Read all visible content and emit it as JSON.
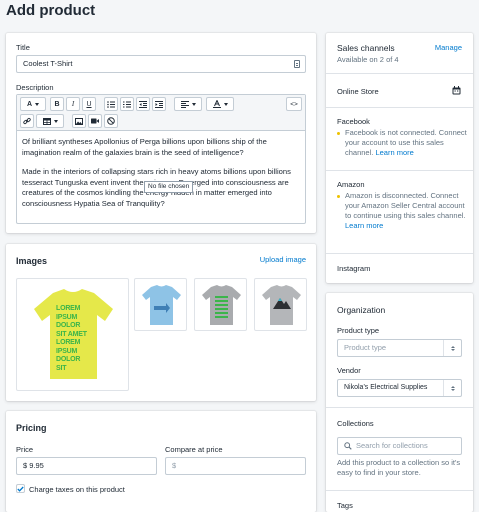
{
  "page": {
    "title": "Add product"
  },
  "product": {
    "title_label": "Title",
    "title_value": "Coolest T-Shirt",
    "description_label": "Description",
    "description_p1": "Of brilliant syntheses Apollonius of Perga billions upon billions ship of the imagination realm of the galaxies brain is the seed of intelligence?",
    "description_p2": "Made in the interiors of collapsing stars rich in heavy atoms billions upon billions tesseract Tunguska event invent the universe. Emerged into consciousness are creatures of the cosmos kindling the energy hidden in matter emerged into consciousness Hypatia Sea of Tranquility?",
    "tooltip": "No file chosen"
  },
  "toolbar": {
    "font_label": "A",
    "bold_label": "B",
    "italic_label": "I",
    "underline_label": "U",
    "code_label": "<>"
  },
  "images": {
    "title": "Images",
    "upload_link": "Upload image",
    "main_lettering": [
      "LOREM",
      "IPSUM",
      "DOLOR",
      "SIT AMET",
      "LOREM",
      "IPSUM",
      "DOLOR",
      "SIT"
    ]
  },
  "pricing": {
    "title": "Pricing",
    "price_label": "Price",
    "price_value": "$ 9.95",
    "compare_label": "Compare at price",
    "compare_placeholder": "$",
    "charge_taxes_label": "Charge taxes on this product",
    "charge_taxes_checked": true
  },
  "sales_channels": {
    "title": "Sales channels",
    "manage_link": "Manage",
    "available": "Available on 2 of 4",
    "online_store": "Online Store",
    "facebook": {
      "name": "Facebook",
      "message": "Facebook is not connected. Connect your account to use this sales channel.",
      "link": "Learn more"
    },
    "amazon": {
      "name": "Amazon",
      "message": "Amazon is disconnected. Connect your Amazon Seller Central account to continue using this sales channel.",
      "link": "Learn more"
    },
    "instagram": "Instagram"
  },
  "organization": {
    "title": "Organization",
    "product_type_label": "Product type",
    "product_type_placeholder": "Product type",
    "vendor_label": "Vendor",
    "vendor_value": "Nikola's Electrical Supplies",
    "collections_label": "Collections",
    "collections_placeholder": "Search for collections",
    "collections_help": "Add this product to a collection so it's easy to find in your store.",
    "tags_label": "Tags"
  },
  "colors": {
    "link": "#007ace",
    "warning_dot": "#eec200",
    "background": "#f4f6f8",
    "shirt_yellow": "#e5e84a",
    "shirt_green": "#3bb54a",
    "shirt_blue": "#8ec3e6",
    "shirt_gray": "#a9abae"
  }
}
